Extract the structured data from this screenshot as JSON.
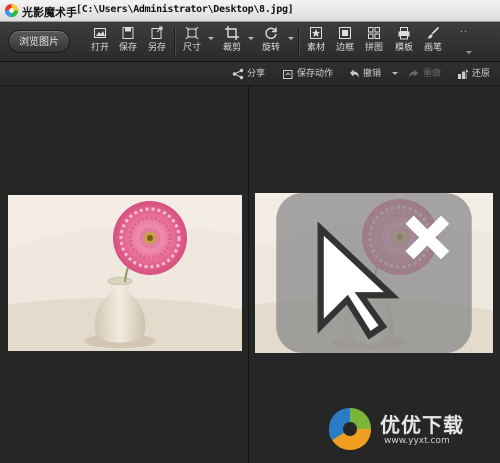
{
  "window": {
    "app_name": "光影魔术手",
    "file_path": "[C:\\Users\\Administrator\\Desktop\\8.jpg]"
  },
  "toolbar": {
    "browse_label": "浏览图片",
    "items": {
      "open": "打开",
      "save": "保存",
      "save_as": "另存",
      "size": "尺寸",
      "crop": "裁剪",
      "rotate": "旋转",
      "material": "素材",
      "border": "边框",
      "collage": "拼图",
      "template": "模板",
      "brush": "画笔"
    },
    "more_icon": "more-icon"
  },
  "actions": {
    "share": "分享",
    "save_action": "保存动作",
    "undo": "撤销",
    "redo": "重做",
    "restore": "还原"
  },
  "watermark": {
    "title": "优优下载",
    "url": "www.yyxt.com"
  },
  "colors": {
    "background": "#252525",
    "toolbar": "#333333",
    "flower": "#e8709a",
    "watermark_green": "#7bb43a",
    "watermark_blue": "#2a7cc4",
    "watermark_orange": "#f0a020"
  }
}
